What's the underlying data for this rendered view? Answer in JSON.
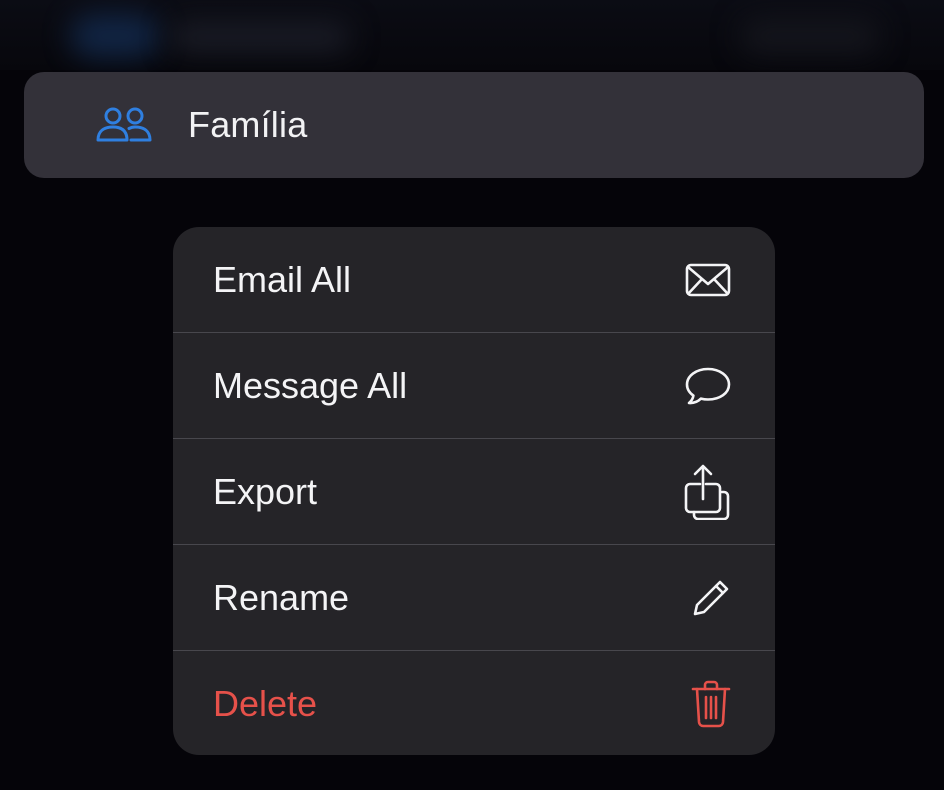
{
  "group": {
    "label": "Família",
    "icon": "person-2-icon",
    "icon_color": "#2f7fe0"
  },
  "context_menu": {
    "items": [
      {
        "label": "Email All",
        "icon": "envelope-icon",
        "destructive": false
      },
      {
        "label": "Message All",
        "icon": "message-bubble-icon",
        "destructive": false
      },
      {
        "label": "Export",
        "icon": "share-icon",
        "destructive": false
      },
      {
        "label": "Rename",
        "icon": "pencil-icon",
        "destructive": false
      },
      {
        "label": "Delete",
        "icon": "trash-icon",
        "destructive": true
      }
    ]
  },
  "colors": {
    "background": "#050409",
    "row_background": "#333139",
    "menu_background": "#252428",
    "separator": "#48474d",
    "destructive": "#e6514a",
    "accent": "#2f7fe0"
  }
}
